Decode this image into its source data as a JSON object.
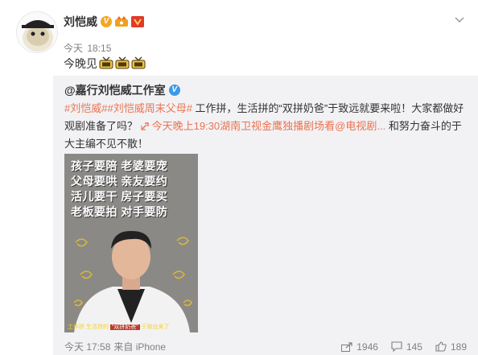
{
  "post": {
    "author": "刘恺威",
    "time_label": "今天",
    "time_value": "18:15",
    "text": "今晚见",
    "tv_icons": [
      "tv-icon",
      "tv-icon",
      "tv-icon"
    ]
  },
  "repost": {
    "author": "@嘉行刘恺威工作室",
    "tag1": "#刘恺威#",
    "tag2": "#刘恺威周末父母#",
    "text1": " 工作拼，生活拼的“双拼奶爸”于致远就要来啦！大家都做好观剧准备了吗？ ",
    "link": "今天晚上19:30湖南卫视金鹰独播剧场看@电视剧...",
    "text2": " 和努力奋斗的于大主编不见不散！",
    "poster_lines": [
      "孩子要陪  老婆要宠",
      "父母要哄  亲友要约",
      "活儿要干  房子要买",
      "老板要拍  对手要防"
    ],
    "poster_caption_a": "工作拼 生活拼的 ",
    "poster_caption_b": "“双拼奶爸”",
    "poster_caption_c": " 于致远来了",
    "footer_time": "今天 17:58",
    "footer_from": "来自 iPhone",
    "shares": "1946",
    "comments": "145",
    "likes": "189"
  },
  "colors": {
    "accent": "#eb7350",
    "verified_blue": "#3a9ae8",
    "verified_orange": "#f5a623",
    "repost_bg": "#f2f2f5"
  }
}
